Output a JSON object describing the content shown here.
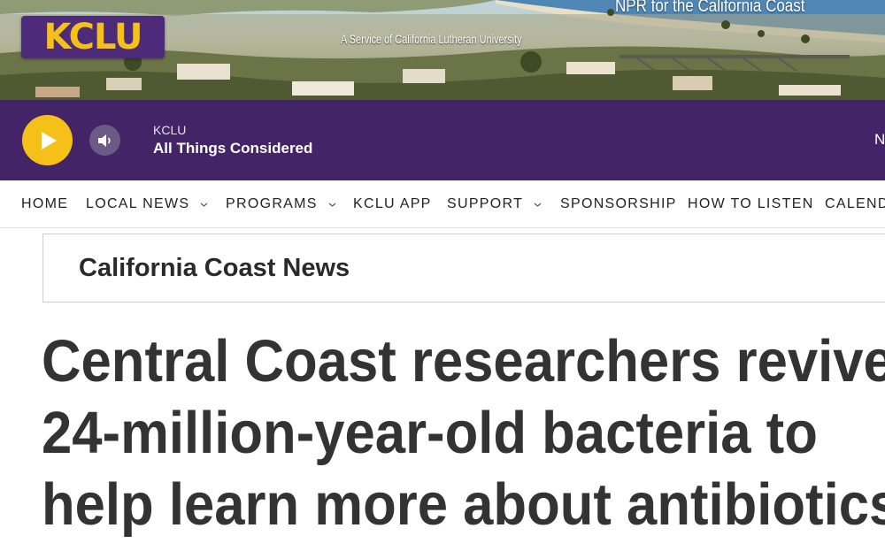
{
  "banner": {
    "logo_text": "KCLU",
    "tagline": "NPR for the California Coast",
    "service_text": "A Service of California Lutheran University"
  },
  "player": {
    "station": "KCLU",
    "program": "All Things Considered",
    "edge_text": "N",
    "icons": {
      "play": "play-icon",
      "volume": "speaker-icon"
    },
    "colors": {
      "bar": "#432466",
      "play": "#f5c018"
    }
  },
  "nav": {
    "items": [
      {
        "label": "HOME",
        "has_dropdown": false
      },
      {
        "label": "LOCAL NEWS",
        "has_dropdown": true
      },
      {
        "label": "PROGRAMS",
        "has_dropdown": true
      },
      {
        "label": "KCLU APP",
        "has_dropdown": false
      },
      {
        "label": "SUPPORT",
        "has_dropdown": true
      },
      {
        "label": "SPONSORSHIP",
        "has_dropdown": false
      },
      {
        "label": "HOW TO LISTEN",
        "has_dropdown": false
      },
      {
        "label": "CALEND",
        "has_dropdown": false
      }
    ]
  },
  "section": {
    "title": "California Coast News"
  },
  "article": {
    "headline_lines": [
      "Central Coast researchers revive",
      "24-million-year-old bacteria to",
      "help learn more about antibiotics"
    ]
  }
}
